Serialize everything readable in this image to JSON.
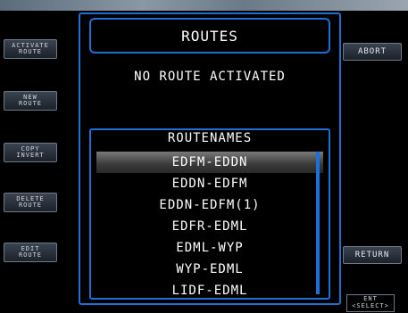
{
  "title": "ROUTES",
  "status_text": "NO ROUTE ACTIVATED",
  "left_softkeys": [
    {
      "line1": "ACTIVATE",
      "line2": "ROUTE"
    },
    {
      "line1": "NEW",
      "line2": "ROUTE"
    },
    {
      "line1": "COPY",
      "line2": "INVERT"
    },
    {
      "line1": "DELETE",
      "line2": "ROUTE"
    },
    {
      "line1": "EDIT",
      "line2": "ROUTE"
    }
  ],
  "right_softkeys": {
    "abort": "ABORT",
    "return": "RETURN"
  },
  "routes_list": {
    "header": "ROUTENAMES",
    "selected_index": 0,
    "items": [
      "EDFM-EDDN",
      "EDDN-EDFM",
      "EDDN-EDFM(1)",
      "EDFR-EDML",
      "EDML-WYP",
      "WYP-EDML",
      "LIDF-EDML"
    ]
  },
  "enter_key": {
    "line1": "ENT",
    "line2": "<SELECT>"
  },
  "colors": {
    "frame": "#1e6fd8",
    "background": "#000000",
    "selected_row": "#5a5a5a"
  }
}
